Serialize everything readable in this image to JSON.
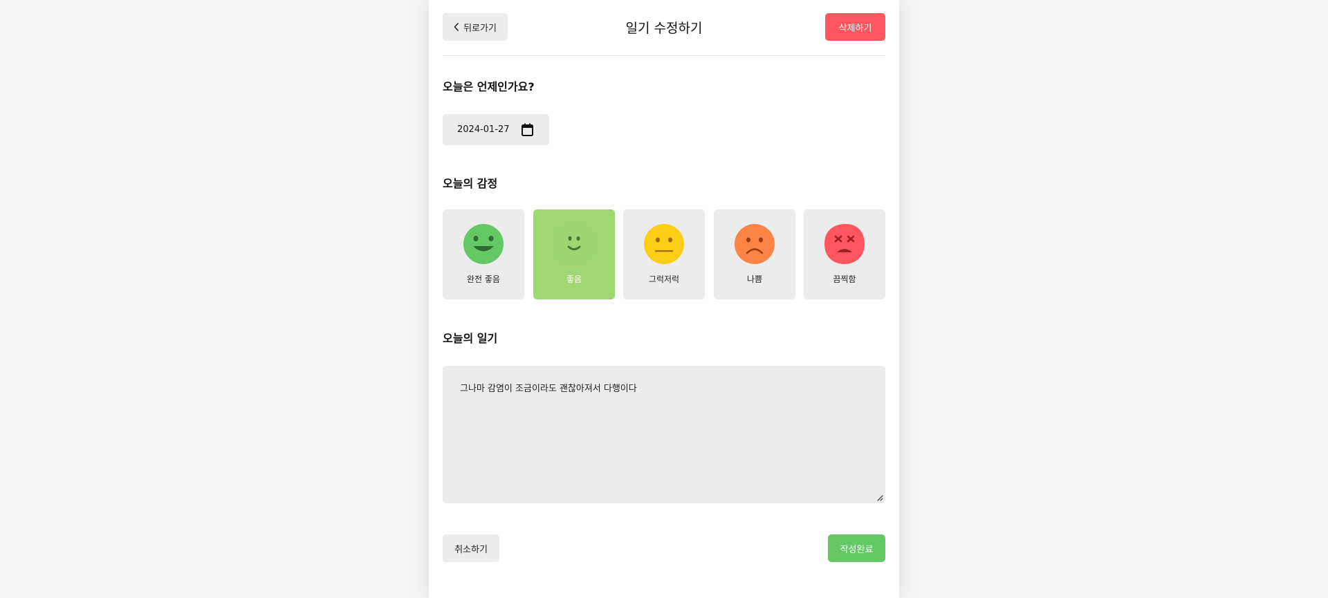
{
  "header": {
    "back_label": "뒤로가기",
    "title": "일기 수정하기",
    "delete_label": "삭제하기"
  },
  "date_section": {
    "title": "오늘은 언제인가요?",
    "date_value": "2024-01-27"
  },
  "emotion_section": {
    "title": "오늘의 감정",
    "selected_index": 1,
    "items": [
      {
        "label": "완전 좋음",
        "icon": "very-happy-face-icon",
        "color": "#64c964"
      },
      {
        "label": "좋음",
        "icon": "happy-face-icon",
        "color": "#9dd772"
      },
      {
        "label": "그럭저럭",
        "icon": "neutral-face-icon",
        "color": "#fdce17"
      },
      {
        "label": "나쁨",
        "icon": "sad-face-icon",
        "color": "#fd8446"
      },
      {
        "label": "끔찍함",
        "icon": "terrible-face-icon",
        "color": "#fd565f"
      }
    ]
  },
  "diary_section": {
    "title": "오늘의 일기",
    "content": "그나마 감염이 조금이라도 괜찮아져서 다행이다"
  },
  "footer": {
    "cancel_label": "취소하기",
    "complete_label": "작성완료"
  },
  "colors": {
    "background": "#f5f5f5",
    "delete": "#fd565f",
    "complete": "#64c964",
    "selected_emotion": "#9fd872",
    "neutral_button": "#ececec"
  }
}
